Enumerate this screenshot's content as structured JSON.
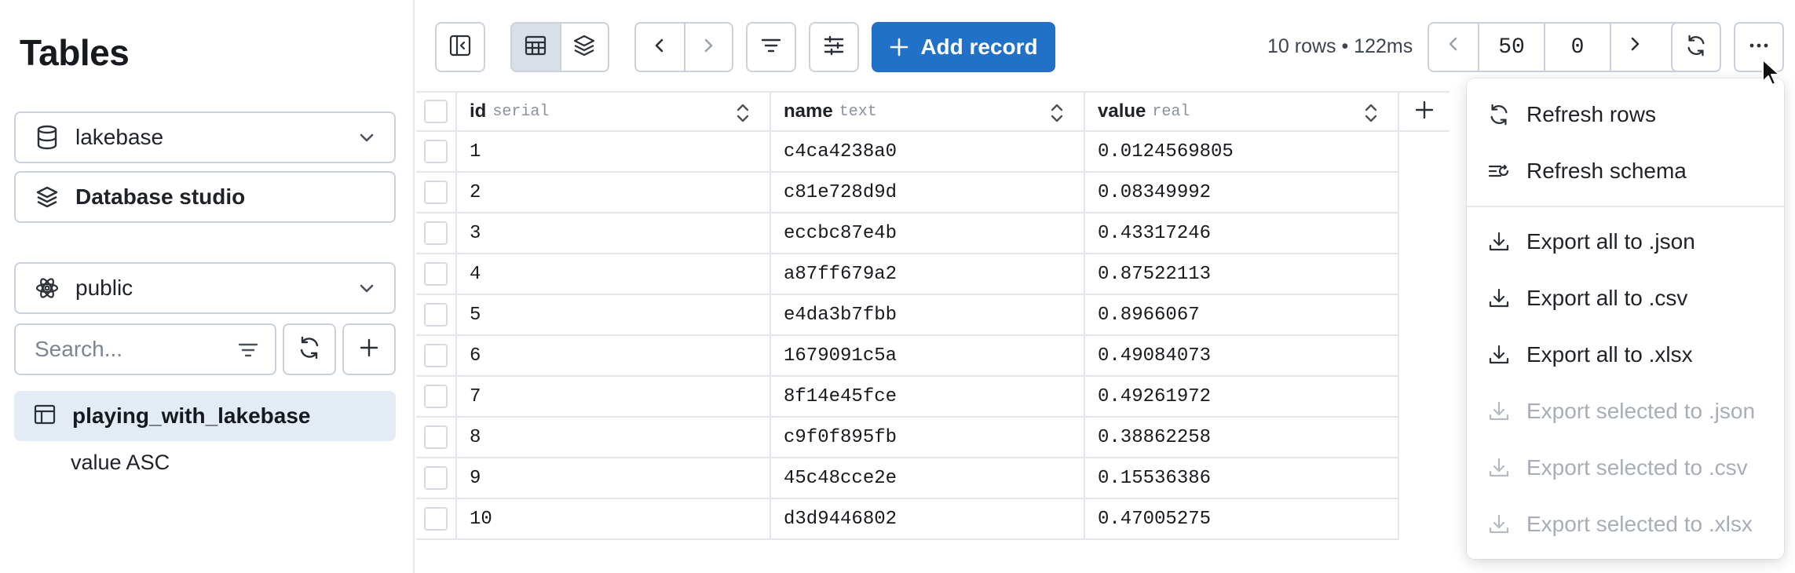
{
  "sidebar": {
    "title": "Tables",
    "database": {
      "label": "lakebase",
      "icon": "database-icon"
    },
    "studio": {
      "label": "Database studio",
      "icon": "layers-icon"
    },
    "schema": {
      "label": "public",
      "icon": "atom-icon"
    },
    "search": {
      "placeholder": "Search..."
    },
    "tables": [
      {
        "label": "playing_with_lakebase",
        "selected": true
      }
    ],
    "sort_label": "value ASC"
  },
  "toolbar": {
    "add_record_label": "Add record",
    "rows_info": "10 rows • 122ms",
    "page_size": "50",
    "offset": "0",
    "accent_color": "#2271c9"
  },
  "grid": {
    "columns": [
      {
        "name": "id",
        "type": "serial"
      },
      {
        "name": "name",
        "type": "text"
      },
      {
        "name": "value",
        "type": "real"
      }
    ],
    "rows": [
      [
        "1",
        "c4ca4238a0",
        "0.0124569805"
      ],
      [
        "2",
        "c81e728d9d",
        "0.08349992"
      ],
      [
        "3",
        "eccbc87e4b",
        "0.43317246"
      ],
      [
        "4",
        "a87ff679a2",
        "0.87522113"
      ],
      [
        "5",
        "e4da3b7fbb",
        "0.8966067"
      ],
      [
        "6",
        "1679091c5a",
        "0.49084073"
      ],
      [
        "7",
        "8f14e45fce",
        "0.49261972"
      ],
      [
        "8",
        "c9f0f895fb",
        "0.38862258"
      ],
      [
        "9",
        "45c48cce2e",
        "0.15536386"
      ],
      [
        "10",
        "d3d9446802",
        "0.47005275"
      ]
    ]
  },
  "menu": {
    "items": [
      {
        "label": "Refresh rows",
        "icon": "refresh-icon",
        "disabled": false
      },
      {
        "label": "Refresh schema",
        "icon": "refresh-schema-icon",
        "disabled": false
      },
      {
        "label": "Export all to .json",
        "icon": "download-icon",
        "disabled": false
      },
      {
        "label": "Export all to .csv",
        "icon": "download-icon",
        "disabled": false
      },
      {
        "label": "Export all to .xlsx",
        "icon": "download-icon",
        "disabled": false
      },
      {
        "label": "Export selected to .json",
        "icon": "download-icon",
        "disabled": true
      },
      {
        "label": "Export selected to .csv",
        "icon": "download-icon",
        "disabled": true
      },
      {
        "label": "Export selected to .xlsx",
        "icon": "download-icon",
        "disabled": true
      }
    ]
  }
}
